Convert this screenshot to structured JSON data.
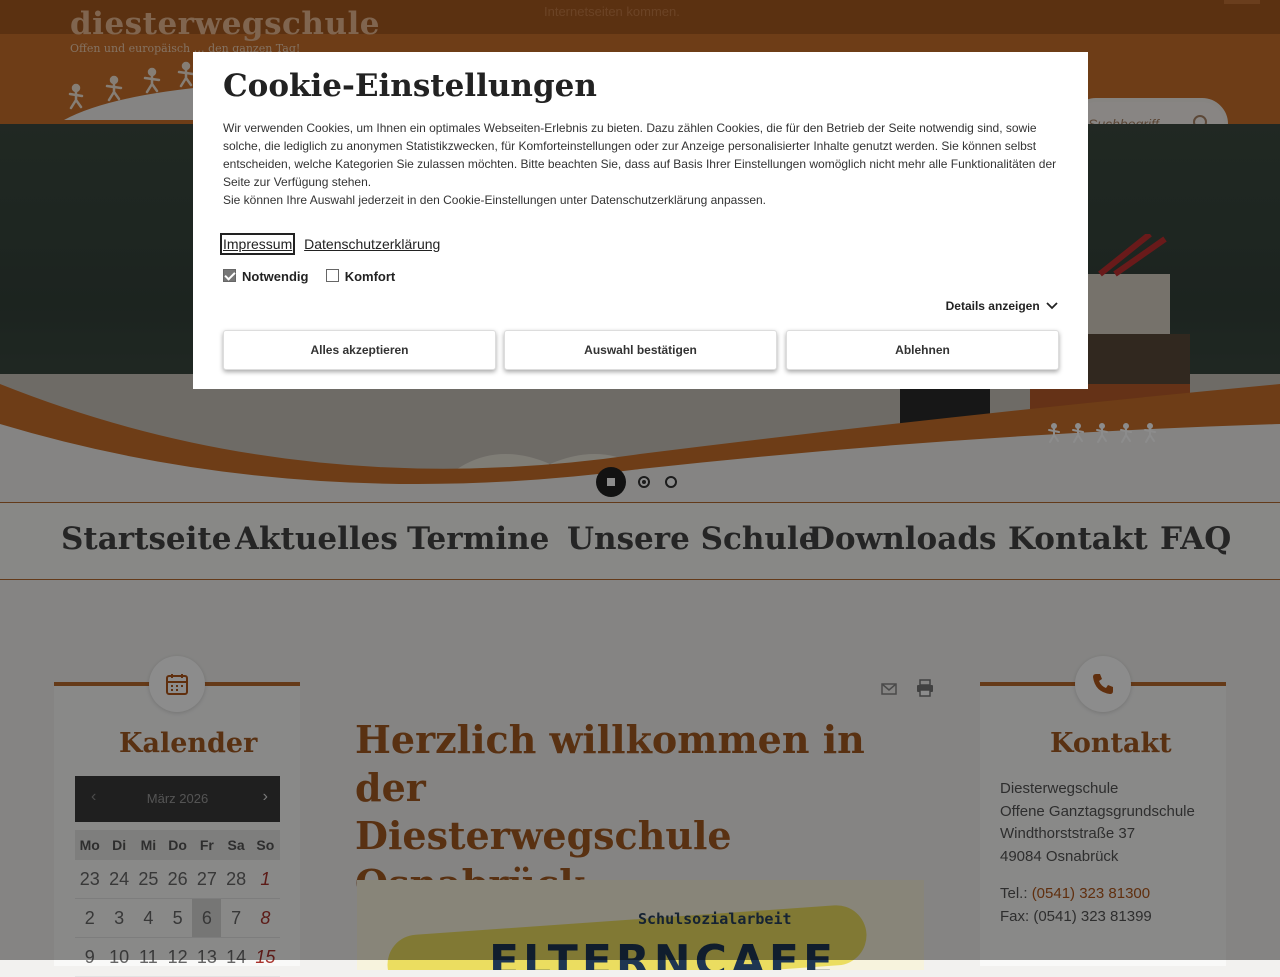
{
  "topbar": {
    "notice": "Internetseiten kommen."
  },
  "logo": {
    "name": "diesterwegschule",
    "tagline": "Offen und europäisch … den ganzen Tag!"
  },
  "search": {
    "placeholder": "Suchbegriff ..."
  },
  "slider": {
    "total": 3,
    "active": 1
  },
  "nav": {
    "items": [
      "Startseite",
      "Aktuelles",
      "Termine",
      "Unsere Schule",
      "Downloads",
      "Kontakt",
      "FAQ"
    ]
  },
  "calendar": {
    "title": "Kalender",
    "month": "März 2026",
    "prev": "‹",
    "next": "›",
    "weekdays": [
      "Mo",
      "Di",
      "Mi",
      "Do",
      "Fr",
      "Sa",
      "So"
    ],
    "rows": [
      [
        "23",
        "24",
        "25",
        "26",
        "27",
        "28",
        "1"
      ],
      [
        "2",
        "3",
        "4",
        "5",
        "6",
        "7",
        "8"
      ],
      [
        "9",
        "10",
        "11",
        "12",
        "13",
        "14",
        "15"
      ]
    ]
  },
  "main": {
    "title_line1": "Herzlich willkommen in der",
    "title_line2": "Diesterwegschule",
    "title_line3": "Osnabrück",
    "teaser_small": "Schulsozialarbeit",
    "teaser_big": "ELTERNCAFE"
  },
  "contact": {
    "title": "Kontakt",
    "line1": "Diesterwegschule",
    "line2": "Offene Ganztagsgrundschule",
    "line3": "Windthorststraße 37",
    "line4": "49084 Osnabrück",
    "tel_label": "Tel.: ",
    "tel": "(0541) 323 81300",
    "fax": "Fax: (0541) 323 81399"
  },
  "cookie": {
    "title": "Cookie-Einstellungen",
    "text1": "Wir verwenden Cookies, um Ihnen ein optimales Webseiten-Erlebnis zu bieten. Dazu zählen Cookies, die für den Betrieb der Seite notwendig sind, sowie solche, die lediglich zu anonymen Statistikzwecken, für Komforteinstellungen oder zur Anzeige personalisierter Inhalte genutzt werden. Sie können selbst entscheiden, welche Kategorien Sie zulassen möchten. Bitte beachten Sie, dass auf Basis Ihrer Einstellungen womöglich nicht mehr alle Funktionalitäten der Seite zur Verfügung stehen.",
    "text2": "Sie können Ihre Auswahl jederzeit in den Cookie-Einstellungen unter Datenschutzerklärung anpassen.",
    "link_impressum": "Impressum",
    "link_datenschutz": "Datenschutzerklärung",
    "check_necessary": "Notwendig",
    "check_comfort": "Komfort",
    "details": "Details anzeigen",
    "btn_accept_all": "Alles akzeptieren",
    "btn_confirm": "Auswahl bestätigen",
    "btn_reject": "Ablehnen"
  },
  "colors": {
    "brand": "#c86f2a",
    "heading": "#a25a22",
    "link": "#b0561a"
  }
}
